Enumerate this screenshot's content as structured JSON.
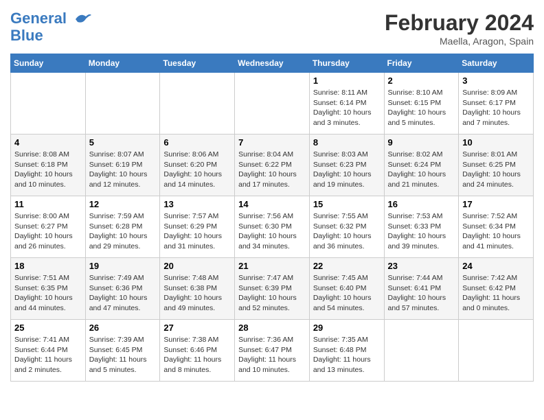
{
  "logo": {
    "line1": "General",
    "line2": "Blue"
  },
  "title": "February 2024",
  "subtitle": "Maella, Aragon, Spain",
  "days_header": [
    "Sunday",
    "Monday",
    "Tuesday",
    "Wednesday",
    "Thursday",
    "Friday",
    "Saturday"
  ],
  "weeks": [
    [
      {
        "day": "",
        "info": ""
      },
      {
        "day": "",
        "info": ""
      },
      {
        "day": "",
        "info": ""
      },
      {
        "day": "",
        "info": ""
      },
      {
        "day": "1",
        "info": "Sunrise: 8:11 AM\nSunset: 6:14 PM\nDaylight: 10 hours\nand 3 minutes."
      },
      {
        "day": "2",
        "info": "Sunrise: 8:10 AM\nSunset: 6:15 PM\nDaylight: 10 hours\nand 5 minutes."
      },
      {
        "day": "3",
        "info": "Sunrise: 8:09 AM\nSunset: 6:17 PM\nDaylight: 10 hours\nand 7 minutes."
      }
    ],
    [
      {
        "day": "4",
        "info": "Sunrise: 8:08 AM\nSunset: 6:18 PM\nDaylight: 10 hours\nand 10 minutes."
      },
      {
        "day": "5",
        "info": "Sunrise: 8:07 AM\nSunset: 6:19 PM\nDaylight: 10 hours\nand 12 minutes."
      },
      {
        "day": "6",
        "info": "Sunrise: 8:06 AM\nSunset: 6:20 PM\nDaylight: 10 hours\nand 14 minutes."
      },
      {
        "day": "7",
        "info": "Sunrise: 8:04 AM\nSunset: 6:22 PM\nDaylight: 10 hours\nand 17 minutes."
      },
      {
        "day": "8",
        "info": "Sunrise: 8:03 AM\nSunset: 6:23 PM\nDaylight: 10 hours\nand 19 minutes."
      },
      {
        "day": "9",
        "info": "Sunrise: 8:02 AM\nSunset: 6:24 PM\nDaylight: 10 hours\nand 21 minutes."
      },
      {
        "day": "10",
        "info": "Sunrise: 8:01 AM\nSunset: 6:25 PM\nDaylight: 10 hours\nand 24 minutes."
      }
    ],
    [
      {
        "day": "11",
        "info": "Sunrise: 8:00 AM\nSunset: 6:27 PM\nDaylight: 10 hours\nand 26 minutes."
      },
      {
        "day": "12",
        "info": "Sunrise: 7:59 AM\nSunset: 6:28 PM\nDaylight: 10 hours\nand 29 minutes."
      },
      {
        "day": "13",
        "info": "Sunrise: 7:57 AM\nSunset: 6:29 PM\nDaylight: 10 hours\nand 31 minutes."
      },
      {
        "day": "14",
        "info": "Sunrise: 7:56 AM\nSunset: 6:30 PM\nDaylight: 10 hours\nand 34 minutes."
      },
      {
        "day": "15",
        "info": "Sunrise: 7:55 AM\nSunset: 6:32 PM\nDaylight: 10 hours\nand 36 minutes."
      },
      {
        "day": "16",
        "info": "Sunrise: 7:53 AM\nSunset: 6:33 PM\nDaylight: 10 hours\nand 39 minutes."
      },
      {
        "day": "17",
        "info": "Sunrise: 7:52 AM\nSunset: 6:34 PM\nDaylight: 10 hours\nand 41 minutes."
      }
    ],
    [
      {
        "day": "18",
        "info": "Sunrise: 7:51 AM\nSunset: 6:35 PM\nDaylight: 10 hours\nand 44 minutes."
      },
      {
        "day": "19",
        "info": "Sunrise: 7:49 AM\nSunset: 6:36 PM\nDaylight: 10 hours\nand 47 minutes."
      },
      {
        "day": "20",
        "info": "Sunrise: 7:48 AM\nSunset: 6:38 PM\nDaylight: 10 hours\nand 49 minutes."
      },
      {
        "day": "21",
        "info": "Sunrise: 7:47 AM\nSunset: 6:39 PM\nDaylight: 10 hours\nand 52 minutes."
      },
      {
        "day": "22",
        "info": "Sunrise: 7:45 AM\nSunset: 6:40 PM\nDaylight: 10 hours\nand 54 minutes."
      },
      {
        "day": "23",
        "info": "Sunrise: 7:44 AM\nSunset: 6:41 PM\nDaylight: 10 hours\nand 57 minutes."
      },
      {
        "day": "24",
        "info": "Sunrise: 7:42 AM\nSunset: 6:42 PM\nDaylight: 11 hours\nand 0 minutes."
      }
    ],
    [
      {
        "day": "25",
        "info": "Sunrise: 7:41 AM\nSunset: 6:44 PM\nDaylight: 11 hours\nand 2 minutes."
      },
      {
        "day": "26",
        "info": "Sunrise: 7:39 AM\nSunset: 6:45 PM\nDaylight: 11 hours\nand 5 minutes."
      },
      {
        "day": "27",
        "info": "Sunrise: 7:38 AM\nSunset: 6:46 PM\nDaylight: 11 hours\nand 8 minutes."
      },
      {
        "day": "28",
        "info": "Sunrise: 7:36 AM\nSunset: 6:47 PM\nDaylight: 11 hours\nand 10 minutes."
      },
      {
        "day": "29",
        "info": "Sunrise: 7:35 AM\nSunset: 6:48 PM\nDaylight: 11 hours\nand 13 minutes."
      },
      {
        "day": "",
        "info": ""
      },
      {
        "day": "",
        "info": ""
      }
    ]
  ]
}
